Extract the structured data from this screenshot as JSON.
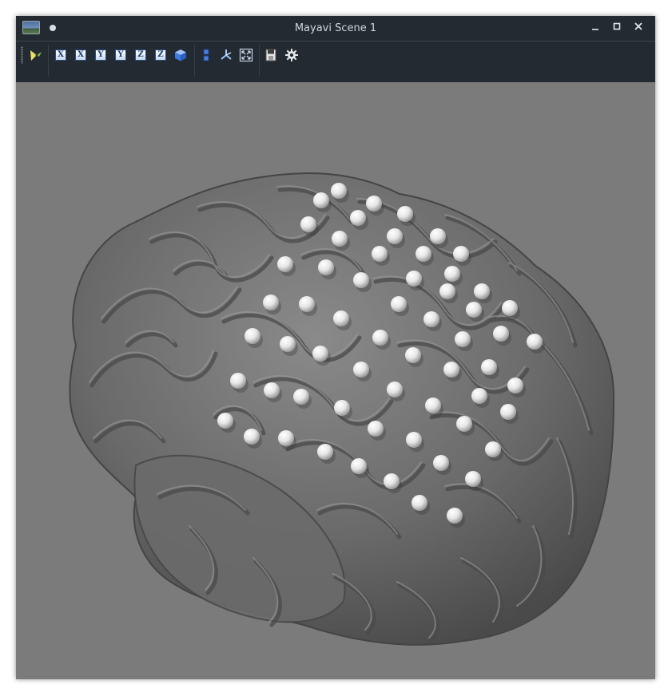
{
  "window": {
    "title": "Mayavi Scene 1"
  },
  "toolbar": {
    "buttons": [
      {
        "name": "mayavi-pipeline-button",
        "icon": "mayavi-pipeline-icon"
      },
      {
        "name": "view-x-positive-button",
        "label": "X"
      },
      {
        "name": "view-x-negative-button",
        "label": "X"
      },
      {
        "name": "view-y-positive-button",
        "label": "Y"
      },
      {
        "name": "view-y-negative-button",
        "label": "Y"
      },
      {
        "name": "view-z-positive-button",
        "label": "Z"
      },
      {
        "name": "view-z-negative-button",
        "label": "Z"
      },
      {
        "name": "isometric-view-button",
        "icon": "cube-icon"
      },
      {
        "name": "parallel-projection-button",
        "icon": "projection-icon"
      },
      {
        "name": "toggle-axes-button",
        "icon": "axes-icon"
      },
      {
        "name": "full-screen-button",
        "icon": "fullscreen-icon"
      },
      {
        "name": "save-scene-button",
        "icon": "save-icon"
      },
      {
        "name": "configure-scene-button",
        "icon": "gear-icon"
      }
    ]
  },
  "colors": {
    "titlebar_bg": "#232a31",
    "scene_bg": "#7b7b7b",
    "brain_surface": "#5f5f5f",
    "electrode": "#f2f2f2"
  }
}
